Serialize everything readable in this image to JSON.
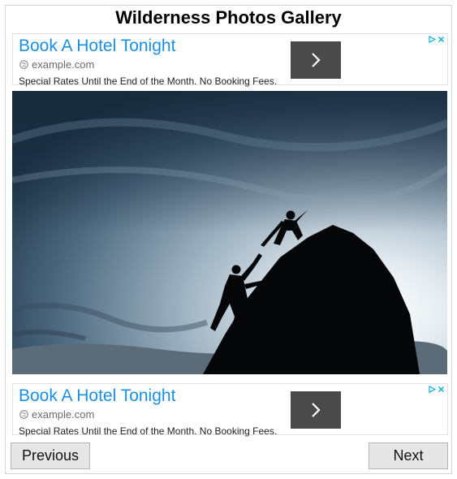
{
  "gallery": {
    "title": "Wilderness Photos Gallery",
    "previous_label": "Previous",
    "next_label": "Next"
  },
  "ads": [
    {
      "headline": "Book A Hotel Tonight",
      "domain": "example.com",
      "description": "Special Rates Until the End of the Month. No Booking Fees.",
      "button_icon": "chevron-right-icon",
      "domain_icon": "globe-icon"
    },
    {
      "headline": "Book A Hotel Tonight",
      "domain": "example.com",
      "description": "Special Rates Until the End of the Month. No Booking Fees.",
      "button_icon": "chevron-right-icon",
      "domain_icon": "globe-icon"
    }
  ],
  "photo": {
    "subject": "two climbers silhouetted on a rock at dusk"
  },
  "colors": {
    "ad_headline": "#1a8fe0",
    "ad_button": "#4a4a4a",
    "adchoices": "#00aecd",
    "nav_button_bg": "#e6e6e6"
  }
}
